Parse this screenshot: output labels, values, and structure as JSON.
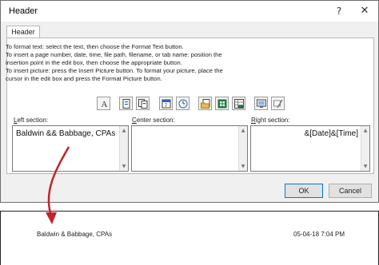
{
  "window": {
    "title": "Header",
    "help_glyph": "?",
    "close_glyph": "✕"
  },
  "tabs": [
    {
      "label": "Header"
    }
  ],
  "instructions": [
    "To format text:  select the text, then choose the Format Text button.",
    "To insert a page number, date, time, file path, filename, or tab name:  position the",
    "     insertion point in the edit box, then choose the appropriate button.",
    "To insert picture: press the Insert Picture button.  To format your picture, place the",
    "     cursor in the edit box and press the Format Picture button."
  ],
  "toolbar": {
    "buttons": [
      {
        "name": "format-text-icon",
        "glyph": "A"
      },
      {
        "name": "insert-page-number-icon"
      },
      {
        "name": "insert-number-of-pages-icon"
      },
      {
        "name": "insert-date-icon"
      },
      {
        "name": "insert-time-icon"
      },
      {
        "name": "insert-file-path-icon"
      },
      {
        "name": "insert-file-name-icon"
      },
      {
        "name": "insert-sheet-name-icon"
      },
      {
        "name": "insert-picture-icon"
      },
      {
        "name": "format-picture-icon"
      }
    ]
  },
  "sections": {
    "left": {
      "label_accel": "L",
      "label_rest": "eft section:",
      "value": "Baldwin && Babbage, CPAs"
    },
    "center": {
      "label_accel": "C",
      "label_rest": "enter section:",
      "value": ""
    },
    "right": {
      "label_accel": "R",
      "label_rest": "ight section:",
      "value": "&[Date]&[Time]"
    }
  },
  "footer": {
    "ok_label": "OK",
    "cancel_label": "Cancel"
  },
  "preview": {
    "left_text": "Baldwin & Babbage, CPAs",
    "right_text": "05-04-18  7:04 PM"
  },
  "colors": {
    "arrow": "#c0242c",
    "ok_border": "#0078d7"
  }
}
